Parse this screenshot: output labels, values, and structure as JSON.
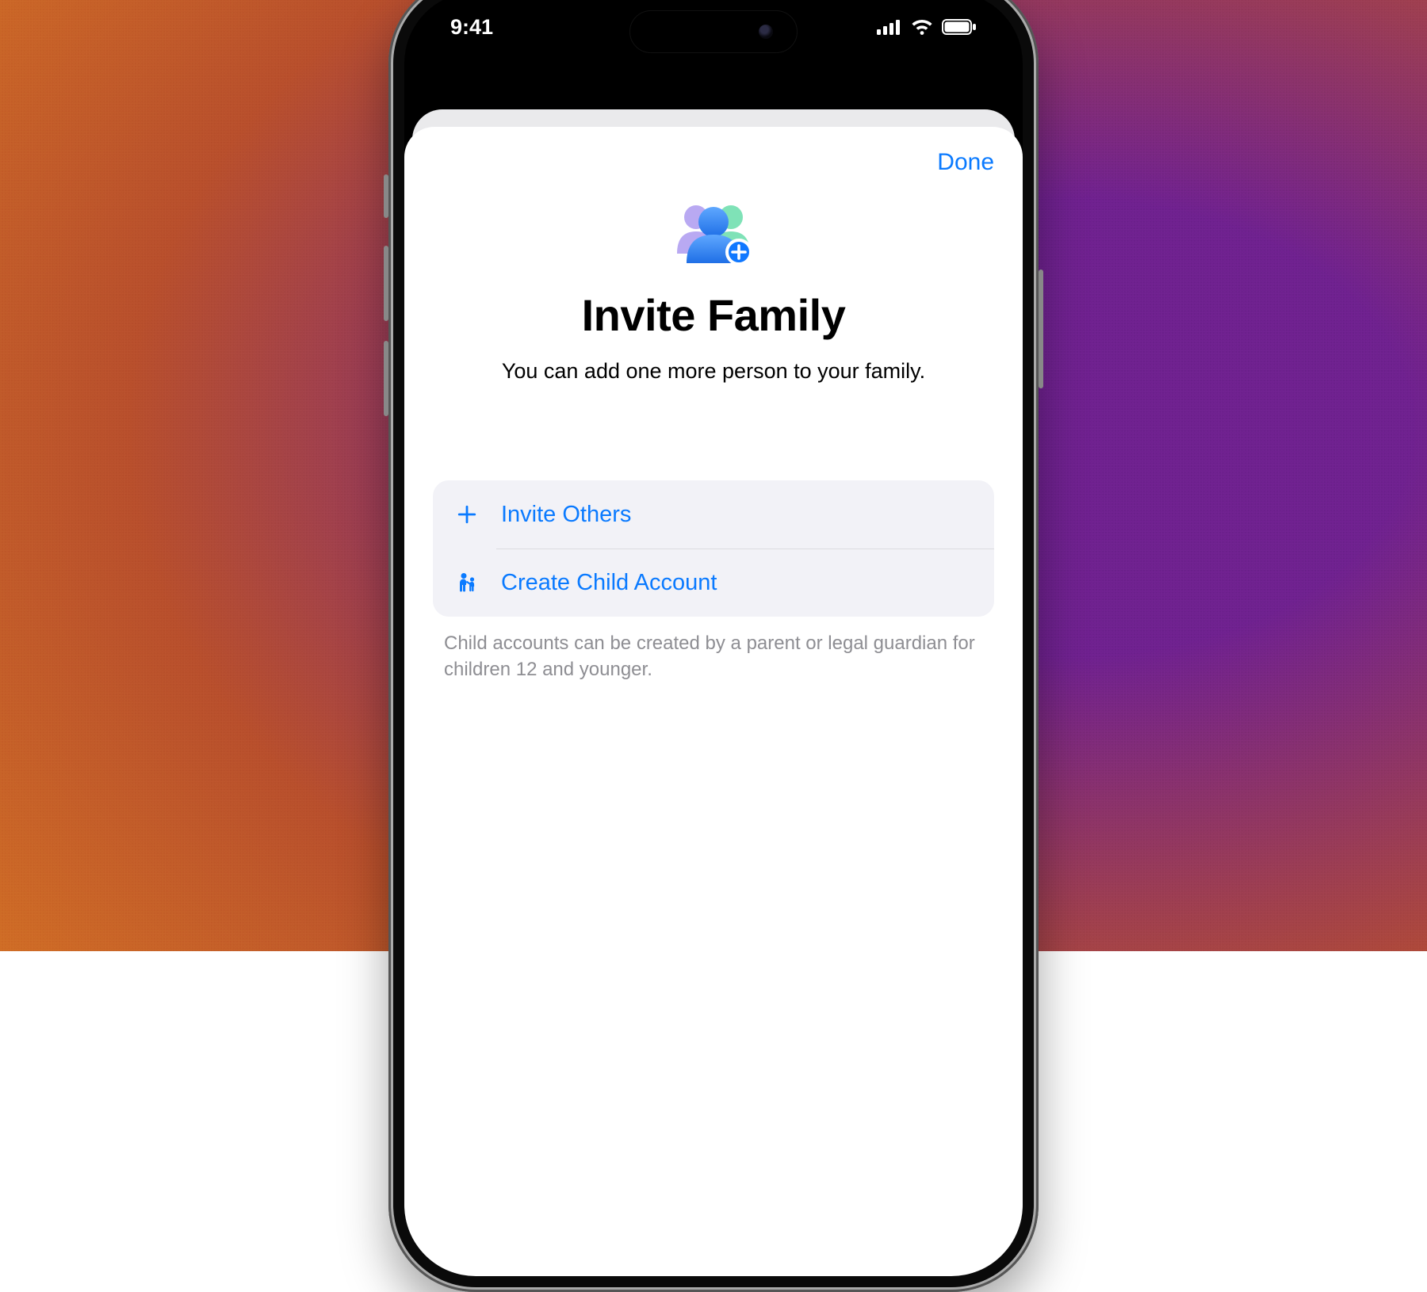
{
  "statusbar": {
    "time": "9:41"
  },
  "nav": {
    "done": "Done"
  },
  "hero": {
    "title": "Invite Family",
    "subtitle": "You can add one more person to your family."
  },
  "options": {
    "invite": "Invite Others",
    "child": "Create Child Account"
  },
  "footnote": "Child accounts can be created by a parent or legal guardian for children 12 and younger."
}
